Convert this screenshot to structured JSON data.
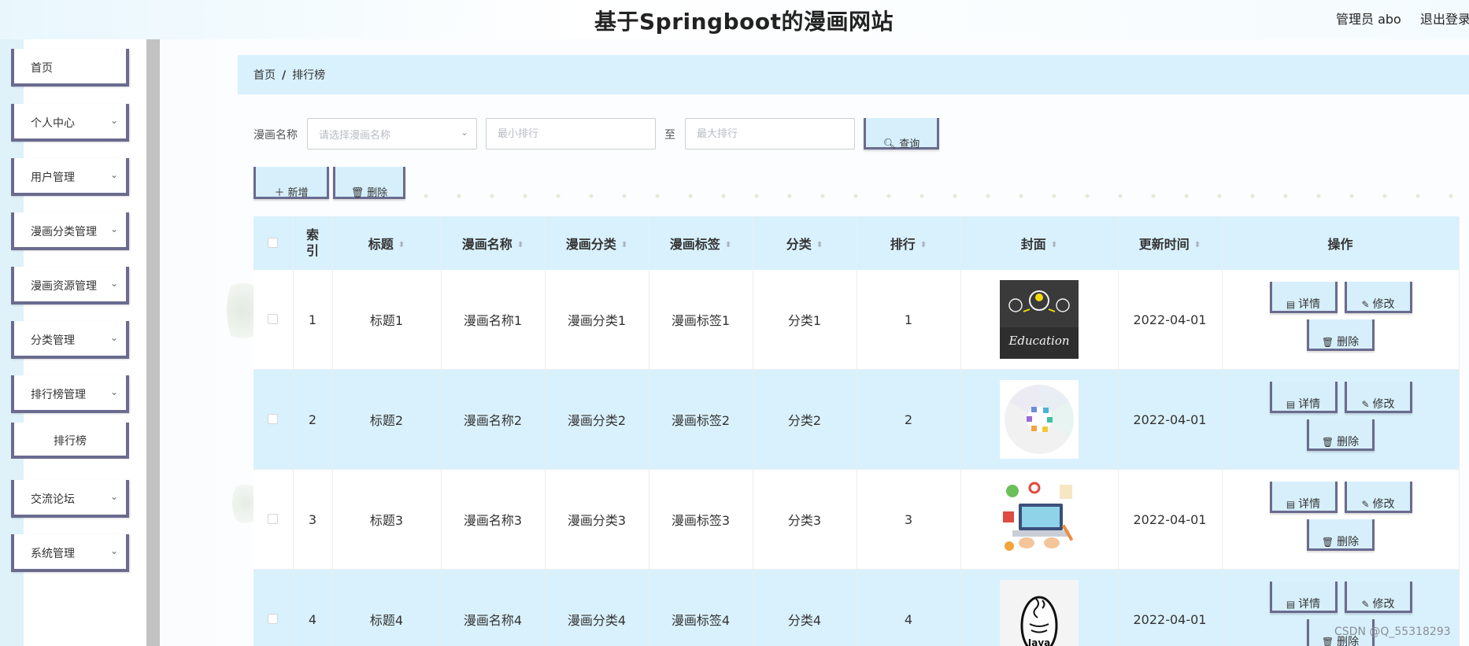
{
  "header": {
    "title": "基于Springboot的漫画网站",
    "admin": "管理员 abo",
    "logout": "退出登录"
  },
  "sidebar": {
    "items": [
      {
        "label": "首页"
      },
      {
        "label": "个人中心"
      },
      {
        "label": "用户管理"
      },
      {
        "label": "漫画分类管理"
      },
      {
        "label": "漫画资源管理"
      },
      {
        "label": "分类管理"
      },
      {
        "label": "排行榜管理"
      },
      {
        "label": "交流论坛"
      },
      {
        "label": "系统管理"
      }
    ],
    "subitem": "排行榜",
    "chevron": "⌄"
  },
  "breadcrumb": {
    "home": "首页",
    "sep": "/",
    "current": "排行榜"
  },
  "search": {
    "label": "漫画名称",
    "select_placeholder": "请选择漫画名称",
    "min_placeholder": "最小排行",
    "to": "至",
    "max_placeholder": "最大排行",
    "query": "查询"
  },
  "toolbar": {
    "add": "新增",
    "delete": "删除"
  },
  "table": {
    "headers": {
      "index": "索引",
      "title": "标题",
      "name": "漫画名称",
      "category": "漫画分类",
      "tag": "漫画标签",
      "class": "分类",
      "rank": "排行",
      "cover": "封面",
      "updated": "更新时间",
      "ops": "操作"
    },
    "rows": [
      {
        "index": "1",
        "title": "标题1",
        "name": "漫画名称1",
        "category": "漫画分类1",
        "tag": "漫画标签1",
        "class": "分类1",
        "rank": "1",
        "updated": "2022-04-01",
        "cover_text": "Education"
      },
      {
        "index": "2",
        "title": "标题2",
        "name": "漫画名称2",
        "category": "漫画分类2",
        "tag": "漫画标签2",
        "class": "分类2",
        "rank": "2",
        "updated": "2022-04-01"
      },
      {
        "index": "3",
        "title": "标题3",
        "name": "漫画名称3",
        "category": "漫画分类3",
        "tag": "漫画标签3",
        "class": "分类3",
        "rank": "3",
        "updated": "2022-04-01"
      },
      {
        "index": "4",
        "title": "标题4",
        "name": "漫画名称4",
        "category": "漫画分类4",
        "tag": "漫画标签4",
        "class": "分类4",
        "rank": "4",
        "updated": "2022-04-01",
        "cover_text": "Java"
      }
    ],
    "ops": {
      "detail": "详情",
      "edit": "修改",
      "delete": "删除"
    }
  },
  "watermark": "CSDN @Q_55318293"
}
